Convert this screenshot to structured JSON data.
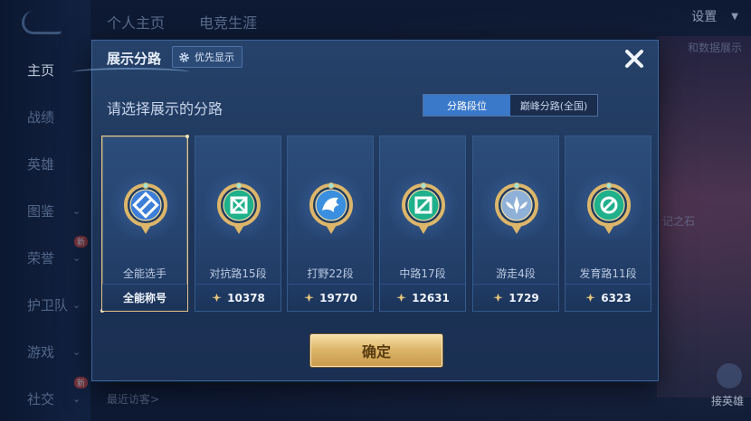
{
  "background": {
    "top_tabs": [
      "个人主页",
      "电竞生涯"
    ],
    "settings_label": "设置",
    "nav_items": [
      {
        "label": "主页",
        "active": true,
        "chevron": false,
        "badge": ""
      },
      {
        "label": "战绩",
        "active": false,
        "chevron": false,
        "badge": ""
      },
      {
        "label": "英雄",
        "active": false,
        "chevron": false,
        "badge": ""
      },
      {
        "label": "图鉴",
        "active": false,
        "chevron": true,
        "badge": ""
      },
      {
        "label": "荣誉",
        "active": false,
        "chevron": true,
        "badge": "新"
      },
      {
        "label": "护卫队",
        "active": false,
        "chevron": true,
        "badge": ""
      },
      {
        "label": "游戏",
        "active": false,
        "chevron": true,
        "badge": ""
      },
      {
        "label": "社交",
        "active": false,
        "chevron": true,
        "badge": "新"
      }
    ],
    "faint_data_label": "和数据展示",
    "faint_stone_label": "记之石",
    "recent_visitors": "最近访客>",
    "bottom_right_label": "接英雄"
  },
  "modal": {
    "title": "展示分路",
    "priority_button": "优先显示",
    "subtitle": "请选择展示的分路",
    "toggle": {
      "options": [
        "分路段位",
        "巅峰分路(全国)"
      ],
      "active_index": 0
    },
    "cards": [
      {
        "name": "全能选手",
        "foot": "全能称号",
        "selected": true,
        "emblem": "all-round-emblem-icon",
        "accent": "#3d7ed8"
      },
      {
        "name": "对抗路15段",
        "foot": "10378",
        "selected": false,
        "emblem": "clash-lane-emblem-icon",
        "accent": "#1fb08c"
      },
      {
        "name": "打野22段",
        "foot": "19770",
        "selected": false,
        "emblem": "jungle-emblem-icon",
        "accent": "#3a8fe0"
      },
      {
        "name": "中路17段",
        "foot": "12631",
        "selected": false,
        "emblem": "mid-lane-emblem-icon",
        "accent": "#1fb08c"
      },
      {
        "name": "游走4段",
        "foot": "1729",
        "selected": false,
        "emblem": "roam-emblem-icon",
        "accent": "#8fb1d8"
      },
      {
        "name": "发育路11段",
        "foot": "6323",
        "selected": false,
        "emblem": "farm-lane-emblem-icon",
        "accent": "#1fb08c"
      }
    ],
    "confirm_label": "确定"
  },
  "colors": {
    "gold": "#ddb66a",
    "teal": "#1fb08c",
    "blue_active": "#3a78c9",
    "panel": "#1d3458"
  }
}
